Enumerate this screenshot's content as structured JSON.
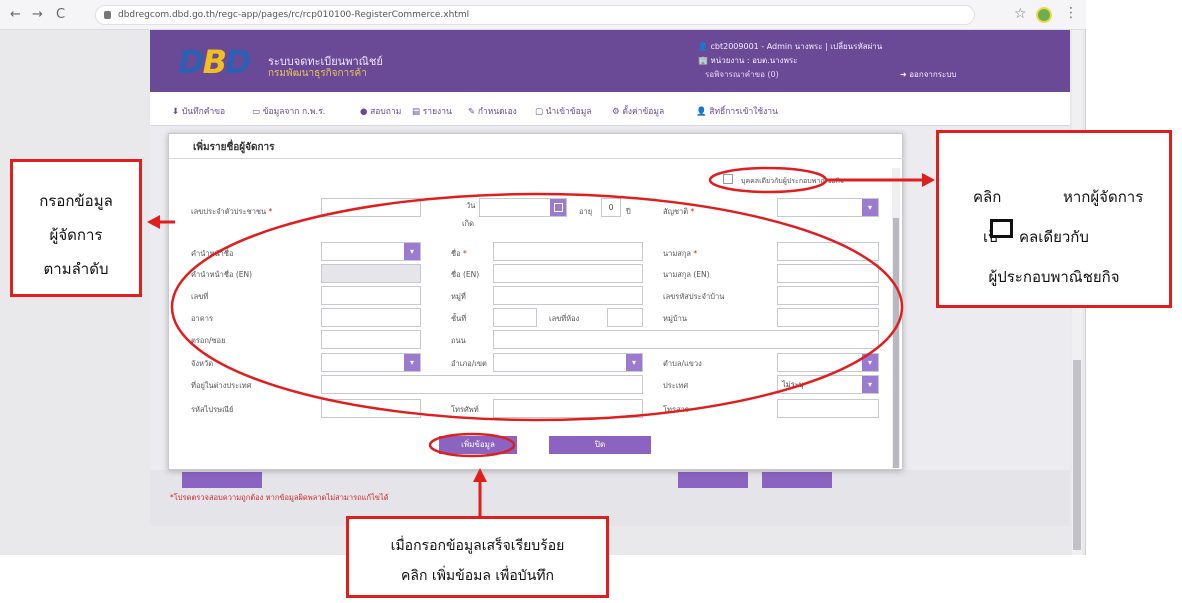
{
  "browser": {
    "url": "dbdregcom.dbd.go.th/regc-app/pages/rc/rcp010100-RegisterCommerce.xhtml",
    "back_glyph": "←",
    "forward_glyph": "→",
    "reload_glyph": "C",
    "star_glyph": "☆",
    "menu_glyph": "⋮"
  },
  "header": {
    "logo_d1": "D",
    "logo_b": "B",
    "logo_d2": "D",
    "site_name": "ระบบจดทะเบียนพาณิชย์",
    "site_sub": "กรมพัฒนาธุรกิจการค้า",
    "user": "👤 cbt2009001 - Admin นางพระ  |  เปลี่ยนรหัสผ่าน",
    "unit": "🏢 หน่วยงาน : อบต.นางพระ",
    "messages": "รอพิจารณาคำขอ (0)",
    "logout": "➜ ออกจากระบบ"
  },
  "menu": {
    "items": [
      "⬇ บันทึกคำขอ",
      "▭ ข้อมูลจาก ก.พ.ร.",
      "● สอบถาม",
      "▤ รายงาน",
      "✎ กำหนดเอง",
      "▢ นำเข้าข้อมูล",
      "⚙ ตั้งค่าข้อมูล",
      "👤 สิทธิ์การเข้าใช้งาน"
    ]
  },
  "modal": {
    "title": "เพิ่มรายชื่อผู้จัดการ",
    "checkbox_label": "บุคคลเดียวกับผู้ประกอบพาณิชยกิจ",
    "labels": {
      "id_number": "เลขประจำตัวประชาชน",
      "birth_date": "วัน",
      "birth_date2": "เกิด",
      "age": "อายุ",
      "age_value": "0",
      "year_unit": "ปี",
      "nationality": "สัญชาติ",
      "prefix": "คำนำหน้าชื่อ",
      "first_name": "ชื่อ",
      "last_name": "นามสกุล",
      "prefix_en": "คำนำหน้าชื่อ (EN)",
      "first_name_en": "ชื่อ (EN)",
      "last_name_en": "นามสกุล (EN)",
      "house_no": "เลขที่",
      "moo": "หมู่ที่",
      "house_code": "เลขรหัสประจำบ้าน",
      "building": "อาคาร",
      "floor": "ชั้นที่",
      "room": "เลขที่ห้อง",
      "village": "หมู่บ้าน",
      "soi": "ตรอก/ซอย",
      "road": "ถนน",
      "province": "จังหวัด",
      "district": "อำเภอ/เขต",
      "subdistrict": "ตำบล/แขวง",
      "foreign_address": "ที่อยู่ในต่างประเทศ",
      "country": "ประเทศ",
      "country_value": "ไม่ระบุ",
      "postal": "รหัสไปรษณีย์",
      "phone": "โทรศัพท์",
      "fax": "โทรสาร",
      "req": "*"
    },
    "add_button": "เพิ่มข้อมูล",
    "close_button": "ปิด"
  },
  "page": {
    "note": "*โปรดตรวจสอบความถูกต้อง หากข้อมูลผิดพลาดไม่สามารถแก้ไขได้"
  },
  "annotations": {
    "left_box": [
      "กรอกข้อมูล",
      "ผู้จัดการ",
      "ตามลำดับ"
    ],
    "right_box_line1_a": "คลิก",
    "right_box_line1_b": "หากผู้จัดการ",
    "right_box_line2_a": "เป็",
    "right_box_line2_b": "คลเดียวกับ",
    "right_box_line3": "ผู้ประกอบพาณิชยกิจ",
    "bottom_box": [
      "เมื่อกรอกข้อมูลเสร็จเรียบร้อย",
      "คลิก เพิ่มข้อมล เพื่อบันทึก"
    ],
    "accent_color": "#e01e1e"
  }
}
